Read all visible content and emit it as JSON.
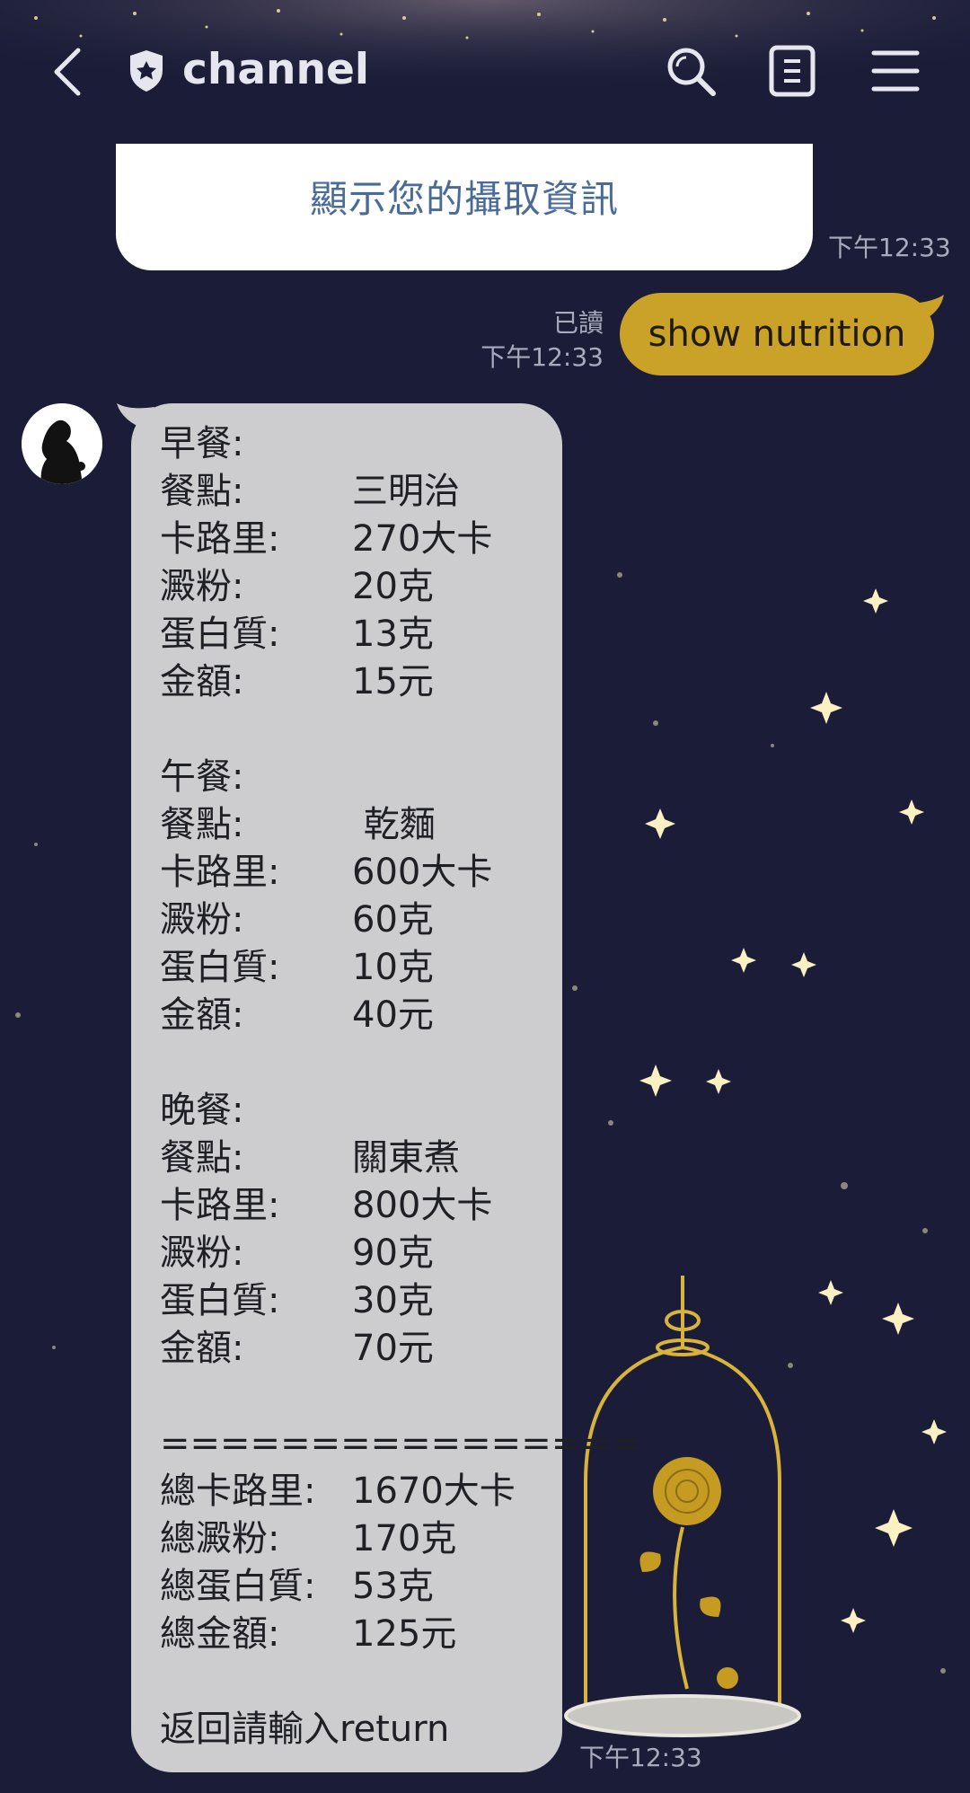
{
  "header": {
    "title": "channel",
    "icons": [
      "back-arrow-icon",
      "shield-icon",
      "search-icon",
      "notes-icon",
      "menu-icon"
    ]
  },
  "messages": {
    "card": {
      "button_label": "顯示您的攝取資訊",
      "time": "下午12:33"
    },
    "sent": {
      "text": "show nutrition",
      "read_status": "已讀",
      "time": "下午12:33"
    },
    "reply": {
      "time": "下午12:33",
      "breakfast": {
        "heading": "早餐:",
        "rows": [
          {
            "label": "餐點:",
            "value": "三明治"
          },
          {
            "label": "卡路里:",
            "value": "270大卡"
          },
          {
            "label": "澱粉:",
            "value": "20克"
          },
          {
            "label": "蛋白質:",
            "value": "13克"
          },
          {
            "label": "金額:",
            "value": "15元"
          }
        ]
      },
      "lunch": {
        "heading": "午餐:",
        "rows": [
          {
            "label": "餐點:",
            "value": " 乾麵"
          },
          {
            "label": "卡路里:",
            "value": "600大卡"
          },
          {
            "label": "澱粉:",
            "value": "60克"
          },
          {
            "label": "蛋白質:",
            "value": "10克"
          },
          {
            "label": "金額:",
            "value": "40元"
          }
        ]
      },
      "dinner": {
        "heading": "晚餐:",
        "rows": [
          {
            "label": "餐點:",
            "value": "關東煮"
          },
          {
            "label": "卡路里:",
            "value": "800大卡"
          },
          {
            "label": "澱粉:",
            "value": "90克"
          },
          {
            "label": "蛋白質:",
            "value": "30克"
          },
          {
            "label": "金額:",
            "value": "70元"
          }
        ]
      },
      "divider": "================",
      "totals": [
        {
          "label": "總卡路里:",
          "value": "1670大卡"
        },
        {
          "label": "總澱粉:",
          "value": "170克"
        },
        {
          "label": "總蛋白質:",
          "value": "53克"
        },
        {
          "label": "總金額:",
          "value": "125元"
        }
      ],
      "footer": "返回請輸入return"
    }
  },
  "colors": {
    "background": "#1b1d38",
    "sent_bubble": "#c9a227",
    "received_bubble": "#cdcdcf",
    "card_button_text": "#4a6b98"
  }
}
